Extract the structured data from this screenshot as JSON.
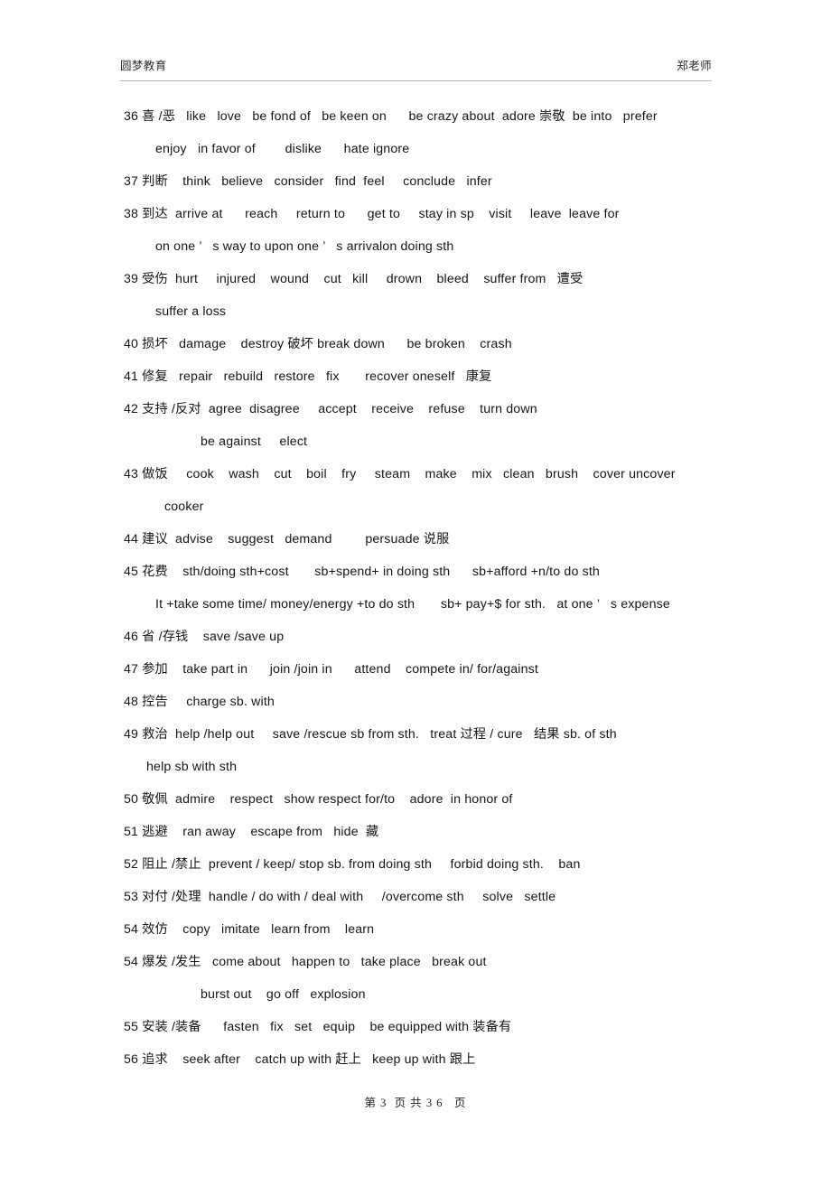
{
  "header": {
    "left": "圆梦教育",
    "right": "郑老师"
  },
  "footer": {
    "text": "第 3  页 共 3 6   页"
  },
  "lines": [
    {
      "id": "entry-36",
      "indent": "main",
      "text": "36 喜 /恶   like   love   be fond of   be keen on      be crazy about  adore 崇敬  be into   prefer"
    },
    {
      "id": "entry-36-cont",
      "indent": "cont",
      "text": "enjoy   in favor of        dislike      hate ignore"
    },
    {
      "id": "entry-37",
      "indent": "main",
      "text": "37 判断    think   believe   consider   find  feel     conclude   infer"
    },
    {
      "id": "entry-38",
      "indent": "main",
      "text": "38 到达  arrive at      reach     return to      get to     stay in sp    visit     leave  leave for"
    },
    {
      "id": "entry-38-cont",
      "indent": "cont",
      "text": "on one ’   s way to upon one ’   s arrivalon doing sth"
    },
    {
      "id": "entry-39",
      "indent": "main",
      "text": "39 受伤  hurt     injured    wound    cut   kill     drown    bleed    suffer from   遭受"
    },
    {
      "id": "entry-39-cont",
      "indent": "cont",
      "text": "suffer a loss"
    },
    {
      "id": "entry-40",
      "indent": "main",
      "text": "40 损坏   damage    destroy 破坏 break down      be broken    crash"
    },
    {
      "id": "entry-41",
      "indent": "main",
      "text": "41 修复   repair   rebuild   restore   fix       recover oneself   康复"
    },
    {
      "id": "entry-42",
      "indent": "main",
      "text": "42 支持 /反对  agree  disagree     accept    receive    refuse    turn down"
    },
    {
      "id": "entry-42-cont",
      "indent": "cont-far",
      "text": "be against     elect"
    },
    {
      "id": "entry-43",
      "indent": "main",
      "text": "43 做饭     cook    wash    cut    boil    fry     steam    make    mix   clean   brush    cover uncover"
    },
    {
      "id": "entry-43-cont",
      "indent": "cont-wide",
      "text": "cooker"
    },
    {
      "id": "entry-44",
      "indent": "main",
      "text": "44 建议  advise    suggest   demand         persuade 说服"
    },
    {
      "id": "entry-45",
      "indent": "main",
      "text": "45 花费    sth/doing sth+cost       sb+spend+ in doing sth      sb+afford +n/to do sth"
    },
    {
      "id": "entry-45-cont",
      "indent": "cont",
      "text": "It +take some time/ money/energy +to do sth       sb+ pay+$ for sth.   at one ’   s expense"
    },
    {
      "id": "entry-46",
      "indent": "main",
      "text": "46 省 /存钱    save /save up"
    },
    {
      "id": "entry-47",
      "indent": "main",
      "text": "47 参加    take part in      join /join in      attend    compete in/ for/against"
    },
    {
      "id": "entry-48",
      "indent": "main",
      "text": "48 控告     charge sb. with"
    },
    {
      "id": "entry-49",
      "indent": "main",
      "text": "49 救治  help /help out     save /rescue sb from sth.   treat 过程 / cure   结果 sb. of sth"
    },
    {
      "id": "entry-49-cont",
      "indent": "cont-mid",
      "text": "help sb with sth"
    },
    {
      "id": "entry-50",
      "indent": "main",
      "text": "50 敬佩  admire    respect   show respect for/to    adore  in honor of"
    },
    {
      "id": "entry-51",
      "indent": "main",
      "text": "51 逃避    ran away    escape from   hide  藏"
    },
    {
      "id": "entry-52",
      "indent": "main",
      "text": "52 阻止 /禁止  prevent / keep/ stop sb. from doing sth     forbid doing sth.    ban"
    },
    {
      "id": "entry-53",
      "indent": "main",
      "text": "53 对付 /处理  handle / do with / deal with     /overcome sth     solve   settle"
    },
    {
      "id": "entry-54a",
      "indent": "main",
      "text": "54 效仿    copy   imitate   learn from    learn"
    },
    {
      "id": "entry-54b",
      "indent": "main",
      "text": "54 爆发 /发生   come about   happen to   take place   break out"
    },
    {
      "id": "entry-54b-cont",
      "indent": "cont-far",
      "text": "burst out    go off   explosion"
    },
    {
      "id": "entry-55",
      "indent": "main",
      "text": "55 安装 /装备      fasten   fix   set   equip    be equipped with 装备有"
    },
    {
      "id": "entry-56",
      "indent": "main",
      "text": "56 追求    seek after    catch up with 赶上   keep up with 跟上"
    }
  ]
}
